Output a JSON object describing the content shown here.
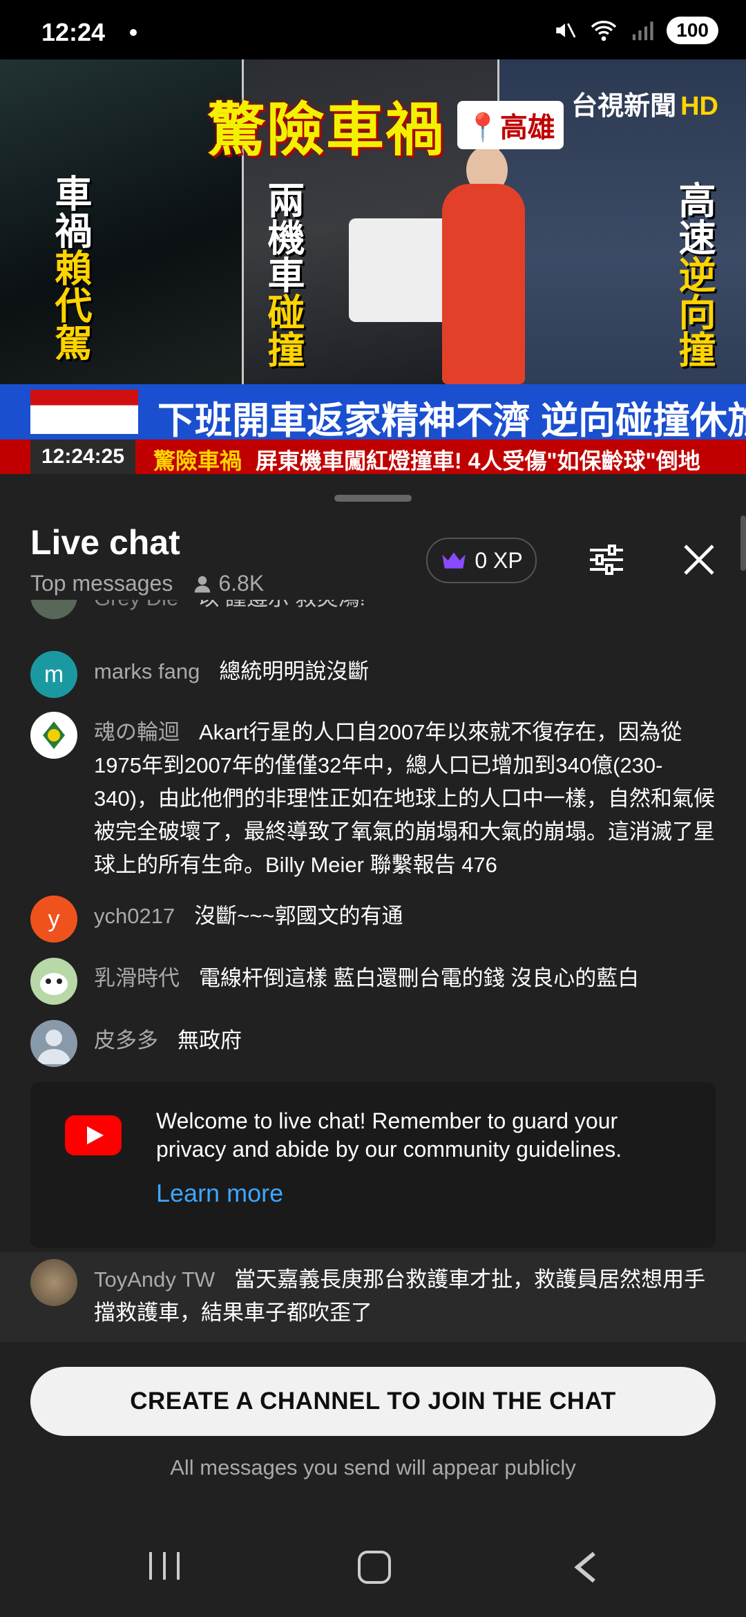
{
  "status_bar": {
    "time": "12:24",
    "battery": "100"
  },
  "video": {
    "headline": "驚險車禍",
    "location": "高雄",
    "channel_logo": "台視新聞",
    "channel_hd": "HD",
    "left_caption_white": "車禍",
    "left_caption_yellow": "賴代駕",
    "mid_caption_white": "兩機車",
    "mid_caption_yellow": "碰撞",
    "right_caption_white": "高速",
    "right_caption_yellow": "逆向撞",
    "lower_third_main": "下班開車返家精神不濟 逆向碰撞休旅車",
    "ticker_time": "12:24:25",
    "ticker_tag": "驚險車禍",
    "ticker_text": "屏東機車闖紅燈撞車! 4人受傷\"如保齡球\"倒地"
  },
  "chat": {
    "title": "Live chat",
    "mode": "Top messages",
    "viewers": "6.8K",
    "xp": "0 XP",
    "partial_author": "Grey Die",
    "partial_text": "以 謹遵示 救災鴻!",
    "messages": [
      {
        "author": "marks fang",
        "text": "總統明明說沒斷",
        "avatar_letter": "m",
        "avatar_color": "#1a9aa0"
      },
      {
        "author": "魂の輪迴",
        "text": "Akart行星的人口自2007年以來就不復存在，因為從1975年到2007年的僅僅32年中，總人口已增加到340億(230-340)，由此他們的非理性正如在地球上的人口中一樣，自然和氣候被完全破壞了，最終導致了氧氣的崩塌和大氣的崩塌。這消滅了星球上的所有生命。Billy Meier 聯繫報告 476",
        "avatar_letter": "",
        "avatar_color": "#ffffff"
      },
      {
        "author": "ych0217",
        "text": "沒斷~~~郭國文的有通",
        "avatar_letter": "y",
        "avatar_color": "#f0521e"
      },
      {
        "author": "乳滑時代",
        "text": "電線杆倒這樣 藍白還刪台電的錢 沒良心的藍白",
        "avatar_letter": "",
        "avatar_color": "#b8d8a8"
      },
      {
        "author": "皮多多",
        "text": "無政府",
        "avatar_letter": "",
        "avatar_color": "#8899aa"
      }
    ],
    "welcome_text": "Welcome to live chat! Remember to guard your privacy and abide by our community guidelines.",
    "learn_more": "Learn more",
    "pinned": {
      "author": "ToyAndy TW",
      "text": "當天嘉義長庚那台救護車才扯，救護員居然想用手擋救護車，結果車子都吹歪了"
    },
    "create_button": "CREATE A CHANNEL TO JOIN THE CHAT",
    "notice": "All messages you send will appear publicly"
  },
  "colors": {
    "accent_blue": "#3ea6ff",
    "brand_red": "#ff0000",
    "xp_crown": "#8a4bff"
  }
}
